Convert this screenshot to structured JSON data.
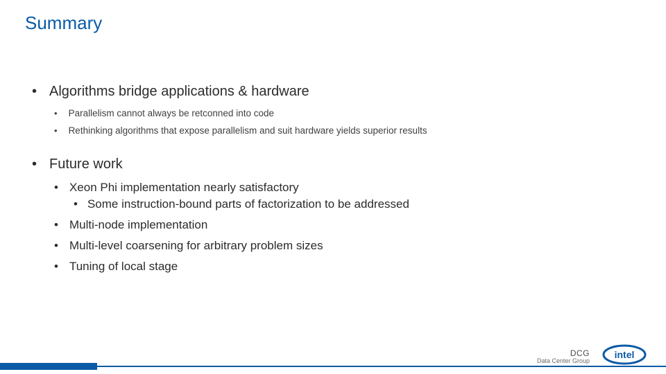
{
  "title": "Summary",
  "points": {
    "p1": {
      "label": "Algorithms bridge applications & hardware",
      "sub": [
        "Parallelism cannot always be retconned into code",
        "Rethinking algorithms that expose parallelism and suit hardware yields superior results"
      ]
    },
    "p2": {
      "label": "Future work",
      "sub": [
        "Xeon Phi implementation nearly satisfactory",
        "Multi-node implementation",
        "Multi-level coarsening for arbitrary problem sizes",
        "Tuning of local stage"
      ],
      "subsub0": "Some instruction-bound parts of factorization to be addressed"
    }
  },
  "footer": {
    "acronym": "DCG",
    "fullname": "Data Center Group",
    "logo_label": "intel"
  }
}
